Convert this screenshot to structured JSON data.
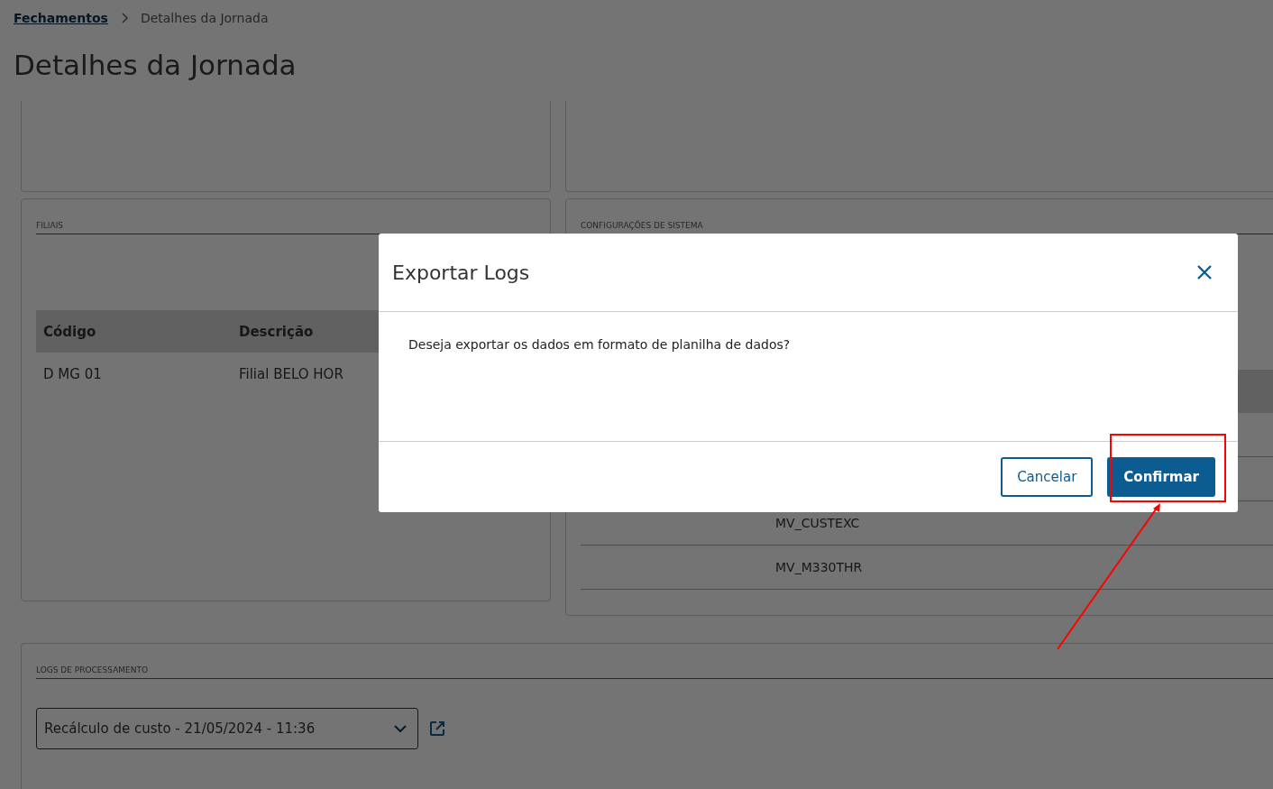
{
  "breadcrumb": [
    {
      "label": "Fechamentos",
      "kind": "link"
    },
    {
      "label": "Detalhes da Jornada",
      "kind": "current"
    }
  ],
  "page_title": "Detalhes da Jornada",
  "filiais": {
    "title": "FILIAIS",
    "columns": [
      "Código",
      "Descrição"
    ],
    "rows": [
      [
        "D MG 01",
        "Filial BELO HOR"
      ]
    ]
  },
  "configuracoes": {
    "title": "CONFIGURAÇÕES DE SISTEMA",
    "rows": [
      {
        "column_2": "MV_CUSTEXC"
      },
      {
        "column_2": "MV_M330THR"
      }
    ]
  },
  "logs": {
    "title": "LOGS DE PROCESSAMENTO",
    "select_value": "Recálculo de custo - 21/05/2024 - 11:36"
  },
  "dialog": {
    "title": "Exportar Logs",
    "message": "Deseja exportar os dados em formato de planilha de dados?",
    "buttons": [
      {
        "label": "Cancelar",
        "kind": "secondary"
      },
      {
        "label": "Confirmar",
        "kind": "primary"
      }
    ]
  }
}
